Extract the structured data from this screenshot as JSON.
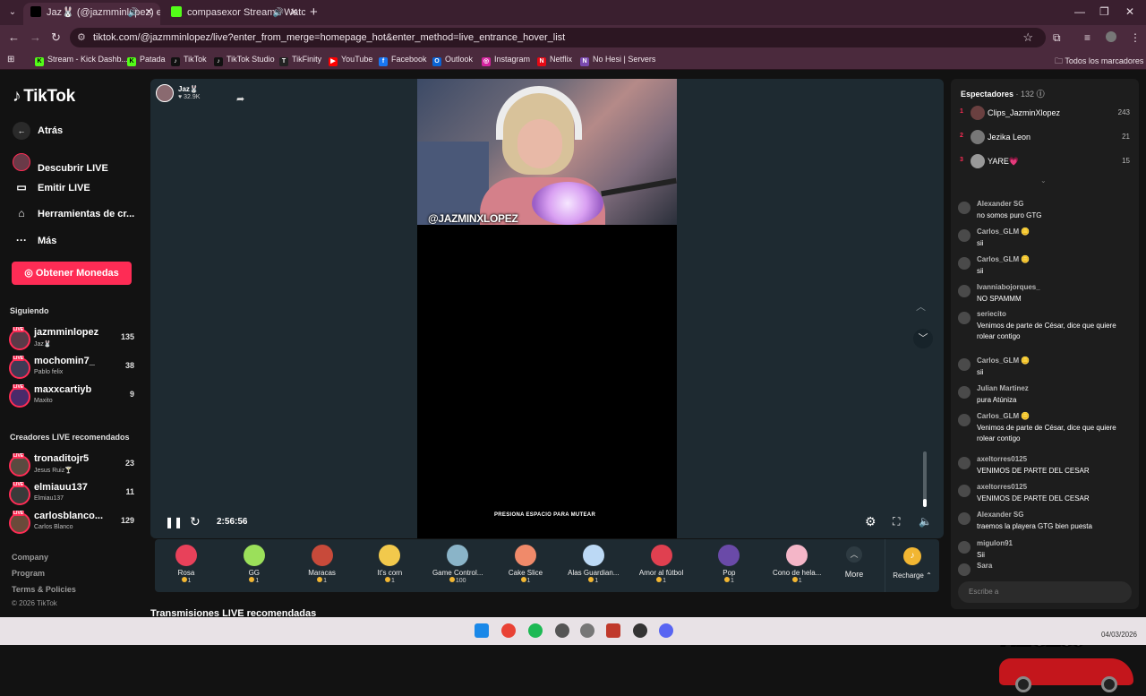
{
  "browser": {
    "tabs": [
      {
        "title": "Jaz🐰 (@jazmminlopez) es"
      },
      {
        "title": "compasexor Stream - Watc"
      }
    ],
    "url": "tiktok.com/@jazmminlopez/live?enter_from_merge=homepage_hot&enter_method=live_entrance_hover_list",
    "bookmarks": [
      "Stream - Kick Dashb...",
      "Patada",
      "TikTok",
      "TikTok Studio",
      "TikFinity",
      "YouTube",
      "Facebook",
      "Outlook",
      "Instagram",
      "Netflix",
      "No Hesi | Servers"
    ],
    "all_bookmarks": "Todos los marcadores"
  },
  "sidebar": {
    "logo": "TikTok",
    "back": "Atrás",
    "nav": [
      {
        "label": "Descubrir LIVE",
        "icon": "live-avatar-icon"
      },
      {
        "label": "Emitir LIVE",
        "icon": "video-camera-icon"
      },
      {
        "label": "Herramientas de cr...",
        "icon": "house-star-icon"
      },
      {
        "label": "Más",
        "icon": "ellipsis-icon"
      }
    ],
    "coins_button": "Obtener Monedas",
    "following_title": "Siguiendo",
    "following": [
      {
        "user": "jazmminlopez",
        "name": "Jaz🐰",
        "count": "135"
      },
      {
        "user": "mochomin7_",
        "name": "Pablo felix",
        "count": "38"
      },
      {
        "user": "maxxcartiyb",
        "name": "Maxito",
        "count": "9"
      }
    ],
    "recommended_title": "Creadores LIVE recomendados",
    "recommended": [
      {
        "user": "tronaditojr5",
        "name": "Jesus Ruiz🍸",
        "count": "23"
      },
      {
        "user": "elmiauu137",
        "name": "Elmiau137",
        "count": "11"
      },
      {
        "user": "carlosblanco...",
        "name": "Carlos Blanco",
        "count": "129"
      }
    ],
    "footer": [
      "Company",
      "Program",
      "Terms & Policies"
    ],
    "copyright": "© 2026 TikTok",
    "live_badge": "LIVE"
  },
  "player": {
    "host_name": "Jaz🐰",
    "host_likes": "♥ 32.9K",
    "overlay_tag": "@JAZMINXLOPEZ",
    "mute_hint": "PRESIONA ESPACIO PARA MUTEAR",
    "elapsed": "2:56:56",
    "volume": 0.15
  },
  "gifts": [
    {
      "name": "Rosa",
      "price": "1",
      "color": "#e8415a"
    },
    {
      "name": "GG",
      "price": "1",
      "color": "#9be05a"
    },
    {
      "name": "Maracas",
      "price": "1",
      "color": "#c84a3a"
    },
    {
      "name": "It's corn",
      "price": "1",
      "color": "#f2c94c"
    },
    {
      "name": "Game Control...",
      "price": "100",
      "color": "#8ab4c8"
    },
    {
      "name": "Cake Slice",
      "price": "1",
      "color": "#f08a6a"
    },
    {
      "name": "Alas Guardian...",
      "price": "1",
      "color": "#bcd9f5"
    },
    {
      "name": "Amor al fútbol",
      "price": "1",
      "color": "#e04050"
    },
    {
      "name": "Pop",
      "price": "1",
      "color": "#6a4aa8"
    },
    {
      "name": "Cono de hela...",
      "price": "1",
      "color": "#f4b6c8"
    }
  ],
  "gifts_more": "More",
  "recharge": "Recharge ⌃",
  "recommended_streams_title": "Transmisiones LIVE recomendadas",
  "viewers": {
    "title": "Espectadores",
    "count": "· 132",
    "top": [
      {
        "rank": "1",
        "name": "Clips_JazminXlopez",
        "score": "243"
      },
      {
        "rank": "2",
        "name": "Jezika Leon",
        "score": "21"
      },
      {
        "rank": "3",
        "name": "YARE💗",
        "score": "15"
      }
    ]
  },
  "chat": [
    {
      "user": "",
      "text": "sii"
    },
    {
      "user": "Alexander SG",
      "text": "no somos puro GTG"
    },
    {
      "user": "Carlos_GLM 🪙",
      "text": "sii"
    },
    {
      "user": "Carlos_GLM 🪙",
      "text": "sii"
    },
    {
      "user": "Ivanniabojorques_",
      "text": "NO SPAMMM"
    },
    {
      "user": "seriecito",
      "text": "Venimos de parte de César, dice que quiere rolear contigo"
    },
    {
      "user": "Carlos_GLM 🪙",
      "text": "sii"
    },
    {
      "user": "Julian Martinez",
      "text": "pura Atúniza"
    },
    {
      "user": "Carlos_GLM 🪙",
      "text": "Venimos de parte de César, dice que quiere rolear contigo"
    },
    {
      "user": "axeltorres0125",
      "text": "VENIMOS DE PARTE DEL CESAR"
    },
    {
      "user": "axeltorres0125",
      "text": "VENIMOS DE PARTE DEL CESAR"
    },
    {
      "user": "Alexander SG",
      "text": "traemos la playera GTG bien puesta"
    },
    {
      "user": "migulon91",
      "text": "Sii"
    },
    {
      "user": "Sara",
      "text": ""
    }
  ],
  "chat_placeholder": "Escribe a",
  "watermark": "HECZ89",
  "taskbar": {
    "date": "04/03/2026"
  },
  "colors": {
    "accent": "#fe2c55",
    "coin": "#f2b632",
    "player_bg": "#1e2a31",
    "browser": "#4b2a3d"
  }
}
